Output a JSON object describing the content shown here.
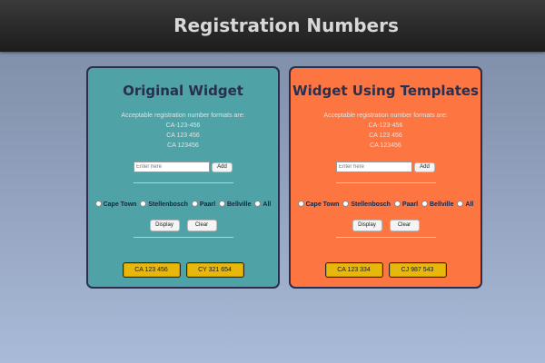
{
  "header": {
    "title": "Registration Numbers"
  },
  "colors": {
    "left_panel": "#4fa2a5",
    "right_panel": "#fd7540",
    "plate": "#e8b70c",
    "header": "#2a2a2a"
  },
  "widgets": [
    {
      "title": "Original Widget",
      "formats_intro": "Acceptable registration number formats are:",
      "formats": [
        "CA-123-456",
        "CA 123 456",
        "CA 123456"
      ],
      "input_placeholder": "Enter here",
      "add_label": "Add",
      "towns": [
        "Cape Town",
        "Stellenbosch",
        "Paarl",
        "Bellville",
        "All"
      ],
      "display_label": "Display",
      "clear_label": "Clear",
      "plates": [
        "CA 123 456",
        "CY 321 654"
      ]
    },
    {
      "title": "Widget Using Templates",
      "formats_intro": "Acceptable registration number formats are:",
      "formats": [
        "CA-123-456",
        "CA 123 456",
        "CA 123456"
      ],
      "input_placeholder": "Enter here",
      "add_label": "Add",
      "towns": [
        "Cape Town",
        "Stellenbosch",
        "Paarl",
        "Bellville",
        "All"
      ],
      "display_label": "Display",
      "clear_label": "Clear",
      "plates": [
        "CA 123 334",
        "CJ 987 543"
      ]
    }
  ]
}
